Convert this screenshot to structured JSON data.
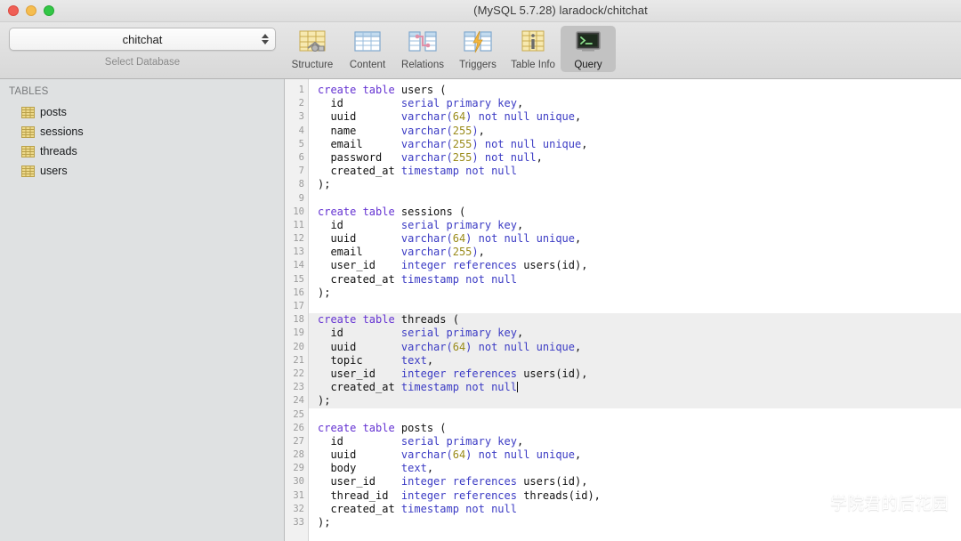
{
  "window": {
    "title": "(MySQL 5.7.28) laradock/chitchat",
    "traffic_lights": [
      "close",
      "minimize",
      "maximize"
    ]
  },
  "database_picker": {
    "selected": "chitchat",
    "caption": "Select Database"
  },
  "toolbar": {
    "items": [
      {
        "label": "Structure",
        "icon": "structure-icon",
        "selected": false
      },
      {
        "label": "Content",
        "icon": "content-icon",
        "selected": false
      },
      {
        "label": "Relations",
        "icon": "relations-icon",
        "selected": false
      },
      {
        "label": "Triggers",
        "icon": "triggers-icon",
        "selected": false
      },
      {
        "label": "Table Info",
        "icon": "table-info-icon",
        "selected": false
      },
      {
        "label": "Query",
        "icon": "query-icon",
        "selected": true
      }
    ]
  },
  "sidebar": {
    "header": "TABLES",
    "tables": [
      {
        "name": "posts",
        "icon": "table-icon"
      },
      {
        "name": "sessions",
        "icon": "table-icon"
      },
      {
        "name": "threads",
        "icon": "table-icon"
      },
      {
        "name": "users",
        "icon": "table-icon"
      }
    ]
  },
  "editor": {
    "highlight_lines": [
      18,
      19,
      20,
      21,
      22,
      23,
      24
    ],
    "caret_line": 23,
    "lines": [
      {
        "n": 1,
        "tokens": [
          {
            "t": "k",
            "s": "create table "
          },
          {
            "t": "p",
            "s": "users ("
          }
        ]
      },
      {
        "n": 2,
        "tokens": [
          {
            "t": "p",
            "s": "  id         "
          },
          {
            "t": "t",
            "s": "serial primary key"
          },
          {
            "t": "p",
            "s": ","
          }
        ]
      },
      {
        "n": 3,
        "tokens": [
          {
            "t": "p",
            "s": "  uuid       "
          },
          {
            "t": "t",
            "s": "varchar("
          },
          {
            "t": "n",
            "s": "64"
          },
          {
            "t": "t",
            "s": ") not null unique"
          },
          {
            "t": "p",
            "s": ","
          }
        ]
      },
      {
        "n": 4,
        "tokens": [
          {
            "t": "p",
            "s": "  name       "
          },
          {
            "t": "t",
            "s": "varchar("
          },
          {
            "t": "n",
            "s": "255"
          },
          {
            "t": "t",
            "s": ")"
          },
          {
            "t": "p",
            "s": ","
          }
        ]
      },
      {
        "n": 5,
        "tokens": [
          {
            "t": "p",
            "s": "  email      "
          },
          {
            "t": "t",
            "s": "varchar("
          },
          {
            "t": "n",
            "s": "255"
          },
          {
            "t": "t",
            "s": ") not null unique"
          },
          {
            "t": "p",
            "s": ","
          }
        ]
      },
      {
        "n": 6,
        "tokens": [
          {
            "t": "p",
            "s": "  password   "
          },
          {
            "t": "t",
            "s": "varchar("
          },
          {
            "t": "n",
            "s": "255"
          },
          {
            "t": "t",
            "s": ") not null"
          },
          {
            "t": "p",
            "s": ","
          }
        ]
      },
      {
        "n": 7,
        "tokens": [
          {
            "t": "p",
            "s": "  created_at "
          },
          {
            "t": "t",
            "s": "timestamp not null"
          }
        ]
      },
      {
        "n": 8,
        "tokens": [
          {
            "t": "p",
            "s": ");"
          }
        ]
      },
      {
        "n": 9,
        "tokens": [
          {
            "t": "p",
            "s": ""
          }
        ]
      },
      {
        "n": 10,
        "tokens": [
          {
            "t": "k",
            "s": "create table "
          },
          {
            "t": "p",
            "s": "sessions ("
          }
        ]
      },
      {
        "n": 11,
        "tokens": [
          {
            "t": "p",
            "s": "  id         "
          },
          {
            "t": "t",
            "s": "serial primary key"
          },
          {
            "t": "p",
            "s": ","
          }
        ]
      },
      {
        "n": 12,
        "tokens": [
          {
            "t": "p",
            "s": "  uuid       "
          },
          {
            "t": "t",
            "s": "varchar("
          },
          {
            "t": "n",
            "s": "64"
          },
          {
            "t": "t",
            "s": ") not null unique"
          },
          {
            "t": "p",
            "s": ","
          }
        ]
      },
      {
        "n": 13,
        "tokens": [
          {
            "t": "p",
            "s": "  email      "
          },
          {
            "t": "t",
            "s": "varchar("
          },
          {
            "t": "n",
            "s": "255"
          },
          {
            "t": "t",
            "s": ")"
          },
          {
            "t": "p",
            "s": ","
          }
        ]
      },
      {
        "n": 14,
        "tokens": [
          {
            "t": "p",
            "s": "  user_id    "
          },
          {
            "t": "t",
            "s": "integer references "
          },
          {
            "t": "p",
            "s": "users(id),"
          }
        ]
      },
      {
        "n": 15,
        "tokens": [
          {
            "t": "p",
            "s": "  created_at "
          },
          {
            "t": "t",
            "s": "timestamp not null"
          }
        ]
      },
      {
        "n": 16,
        "tokens": [
          {
            "t": "p",
            "s": ");"
          }
        ]
      },
      {
        "n": 17,
        "tokens": [
          {
            "t": "p",
            "s": ""
          }
        ]
      },
      {
        "n": 18,
        "tokens": [
          {
            "t": "k",
            "s": "create table "
          },
          {
            "t": "p",
            "s": "threads ("
          }
        ]
      },
      {
        "n": 19,
        "tokens": [
          {
            "t": "p",
            "s": "  id         "
          },
          {
            "t": "t",
            "s": "serial primary key"
          },
          {
            "t": "p",
            "s": ","
          }
        ]
      },
      {
        "n": 20,
        "tokens": [
          {
            "t": "p",
            "s": "  uuid       "
          },
          {
            "t": "t",
            "s": "varchar("
          },
          {
            "t": "n",
            "s": "64"
          },
          {
            "t": "t",
            "s": ") not null unique"
          },
          {
            "t": "p",
            "s": ","
          }
        ]
      },
      {
        "n": 21,
        "tokens": [
          {
            "t": "p",
            "s": "  topic      "
          },
          {
            "t": "t",
            "s": "text"
          },
          {
            "t": "p",
            "s": ","
          }
        ]
      },
      {
        "n": 22,
        "tokens": [
          {
            "t": "p",
            "s": "  user_id    "
          },
          {
            "t": "t",
            "s": "integer references "
          },
          {
            "t": "p",
            "s": "users(id),"
          }
        ]
      },
      {
        "n": 23,
        "tokens": [
          {
            "t": "p",
            "s": "  created_at "
          },
          {
            "t": "t",
            "s": "timestamp not null"
          }
        ]
      },
      {
        "n": 24,
        "tokens": [
          {
            "t": "p",
            "s": ");"
          }
        ]
      },
      {
        "n": 25,
        "tokens": [
          {
            "t": "p",
            "s": ""
          }
        ]
      },
      {
        "n": 26,
        "tokens": [
          {
            "t": "k",
            "s": "create table "
          },
          {
            "t": "p",
            "s": "posts ("
          }
        ]
      },
      {
        "n": 27,
        "tokens": [
          {
            "t": "p",
            "s": "  id         "
          },
          {
            "t": "t",
            "s": "serial primary key"
          },
          {
            "t": "p",
            "s": ","
          }
        ]
      },
      {
        "n": 28,
        "tokens": [
          {
            "t": "p",
            "s": "  uuid       "
          },
          {
            "t": "t",
            "s": "varchar("
          },
          {
            "t": "n",
            "s": "64"
          },
          {
            "t": "t",
            "s": ") not null unique"
          },
          {
            "t": "p",
            "s": ","
          }
        ]
      },
      {
        "n": 29,
        "tokens": [
          {
            "t": "p",
            "s": "  body       "
          },
          {
            "t": "t",
            "s": "text"
          },
          {
            "t": "p",
            "s": ","
          }
        ]
      },
      {
        "n": 30,
        "tokens": [
          {
            "t": "p",
            "s": "  user_id    "
          },
          {
            "t": "t",
            "s": "integer references "
          },
          {
            "t": "p",
            "s": "users(id),"
          }
        ]
      },
      {
        "n": 31,
        "tokens": [
          {
            "t": "p",
            "s": "  thread_id  "
          },
          {
            "t": "t",
            "s": "integer references "
          },
          {
            "t": "p",
            "s": "threads(id),"
          }
        ]
      },
      {
        "n": 32,
        "tokens": [
          {
            "t": "p",
            "s": "  created_at "
          },
          {
            "t": "t",
            "s": "timestamp not null"
          }
        ]
      },
      {
        "n": 33,
        "tokens": [
          {
            "t": "p",
            "s": ");"
          }
        ]
      }
    ]
  },
  "watermark": {
    "text": "学院君的后花园",
    "icon": "wechat-icon"
  },
  "colors": {
    "keyword": "#6432d2",
    "type": "#3b3bc4",
    "number": "#9a8b1a",
    "plain": "#111111",
    "highlight_band": "#eeeeee",
    "sidebar_bg": "#dfe1e2",
    "toolbar_bg": "#e0e0e0",
    "table_icon": "#e8cf7a"
  }
}
